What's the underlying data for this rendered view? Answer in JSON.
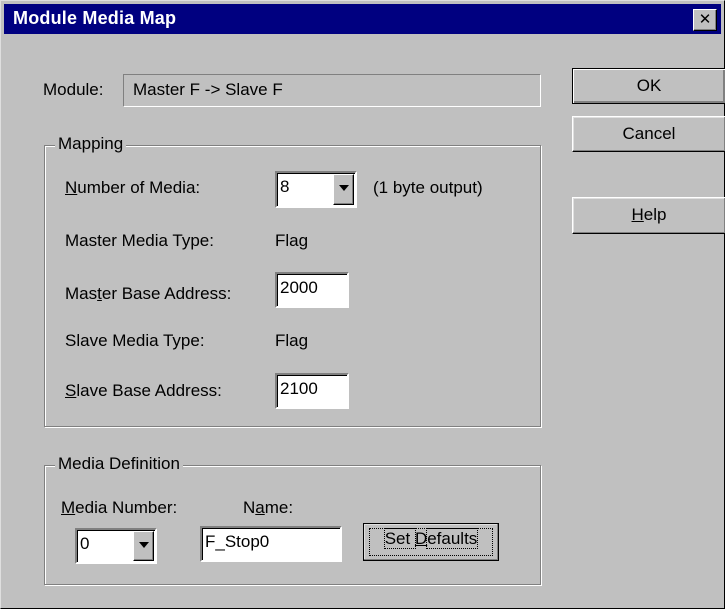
{
  "window": {
    "title": "Module Media Map",
    "close_glyph": "✕"
  },
  "module": {
    "label": "Module:",
    "value": "Master F -> Slave F"
  },
  "buttons": {
    "ok": "OK",
    "cancel": "Cancel",
    "help_mnemonic": "H",
    "help_rest": "elp"
  },
  "mapping": {
    "group_title": "Mapping",
    "number_of_media_mnemonic": "N",
    "number_of_media_rest": "umber of Media:",
    "number_of_media_value": "8",
    "output_note": "(1 byte output)",
    "master_media_type_label": "Master Media Type:",
    "master_media_type_value": "Flag",
    "master_base_address_pre": "Mas",
    "master_base_address_mnemonic": "t",
    "master_base_address_post": "er Base Address:",
    "master_base_address_value": "2000",
    "slave_media_type_label": "Slave Media Type:",
    "slave_media_type_value": "Flag",
    "slave_base_address_mnemonic": "S",
    "slave_base_address_rest": "lave Base Address:",
    "slave_base_address_value": "2100"
  },
  "media_definition": {
    "group_title": "Media Definition",
    "media_number_mnemonic": "M",
    "media_number_rest": "edia Number:",
    "media_number_value": "0",
    "name_pre": "N",
    "name_mnemonic": "a",
    "name_post": "me:",
    "name_value": "F_Stop0",
    "set_defaults_pre": "Set ",
    "set_defaults_mnemonic": "D",
    "set_defaults_post": "efaults"
  },
  "colors": {
    "titlebar": "#000080",
    "face": "#c0c0c0"
  }
}
